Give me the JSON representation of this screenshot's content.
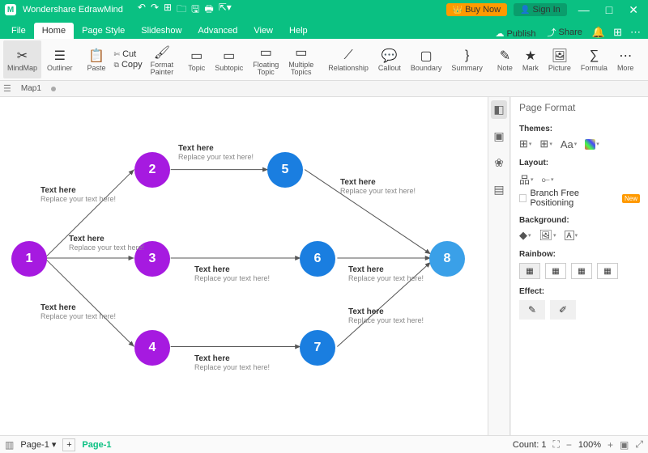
{
  "app": {
    "name": "Wondershare EdrawMind",
    "buy": "Buy Now",
    "signin": "Sign In"
  },
  "menu": {
    "file": "File",
    "home": "Home",
    "pagestyle": "Page Style",
    "slideshow": "Slideshow",
    "advanced": "Advanced",
    "view": "View",
    "help": "Help",
    "publish": "Publish",
    "share": "Share"
  },
  "ribbon": {
    "mindmap": "MindMap",
    "outliner": "Outliner",
    "paste": "Paste",
    "cut": "Cut",
    "copy": "Copy",
    "format": "Format\nPainter",
    "topic": "Topic",
    "subtopic": "Subtopic",
    "floating": "Floating\nTopic",
    "multiple": "Multiple\nTopics",
    "relationship": "Relationship",
    "callout": "Callout",
    "boundary": "Boundary",
    "summary": "Summary",
    "note": "Note",
    "mark": "Mark",
    "picture": "Picture",
    "formula": "Formula",
    "more": "More"
  },
  "tabs": {
    "map": "Map1"
  },
  "nodes": {
    "n1": "1",
    "n2": "2",
    "n3": "3",
    "n4": "4",
    "n5": "5",
    "n6": "6",
    "n7": "7",
    "n8": "8",
    "label_title": "Text here",
    "label_sub": "Replace your text here!"
  },
  "panel": {
    "title": "Page Format",
    "themes": "Themes:",
    "layout": "Layout:",
    "branch": "Branch Free Positioning",
    "new": "New",
    "background": "Background:",
    "rainbow": "Rainbow:",
    "effect": "Effect:"
  },
  "status": {
    "page": "Page-1",
    "pagegreen": "Page-1",
    "count": "Count: 1",
    "zoom": "100%"
  }
}
